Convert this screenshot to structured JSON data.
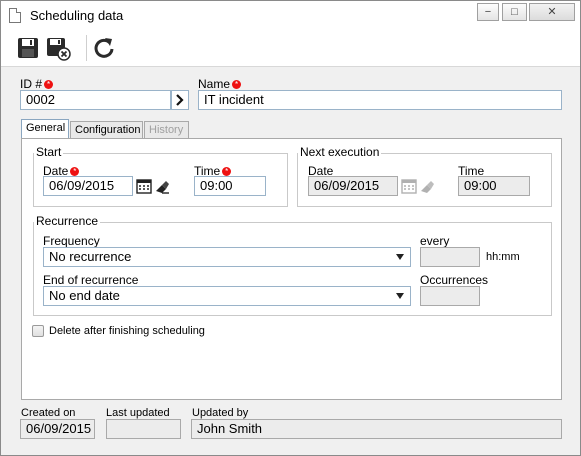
{
  "window": {
    "title": "Scheduling data",
    "minimize_glyph": "−",
    "maximize_glyph": "□",
    "close_glyph": "✕"
  },
  "toolbar": {
    "icons": [
      "save-icon",
      "save-and-close-icon",
      "refresh-icon"
    ]
  },
  "header": {
    "id_label": "ID #",
    "id_value": "0002",
    "name_label": "Name",
    "name_value": "IT incident"
  },
  "tabs": [
    {
      "label": "General",
      "state": "active"
    },
    {
      "label": "Configuration",
      "state": "normal"
    },
    {
      "label": "History",
      "state": "disabled"
    }
  ],
  "start": {
    "group_label": "Start",
    "date_label": "Date",
    "date_value": "06/09/2015",
    "time_label": "Time",
    "time_value": "09:00"
  },
  "next_execution": {
    "group_label": "Next execution",
    "date_label": "Date",
    "date_value": "06/09/2015",
    "time_label": "Time",
    "time_value": "09:00"
  },
  "recurrence": {
    "group_label": "Recurrence",
    "frequency_label": "Frequency",
    "frequency_value": "No recurrence",
    "every_label": "every",
    "every_value": "",
    "every_unit": "hh:mm",
    "end_label": "End of recurrence",
    "end_value": "No end date",
    "occurrences_label": "Occurrences",
    "occurrences_value": ""
  },
  "options": {
    "delete_after_label": "Delete after finishing scheduling",
    "delete_after_checked": false
  },
  "footer": {
    "created_on_label": "Created on",
    "created_on_value": "06/09/2015",
    "last_updated_label": "Last updated",
    "last_updated_value": "",
    "updated_by_label": "Updated by",
    "updated_by_value": "John Smith"
  },
  "colors": {
    "required_marker": "#e11111",
    "field_border": "#9ab3c9",
    "readonly_bg": "#ececec"
  }
}
